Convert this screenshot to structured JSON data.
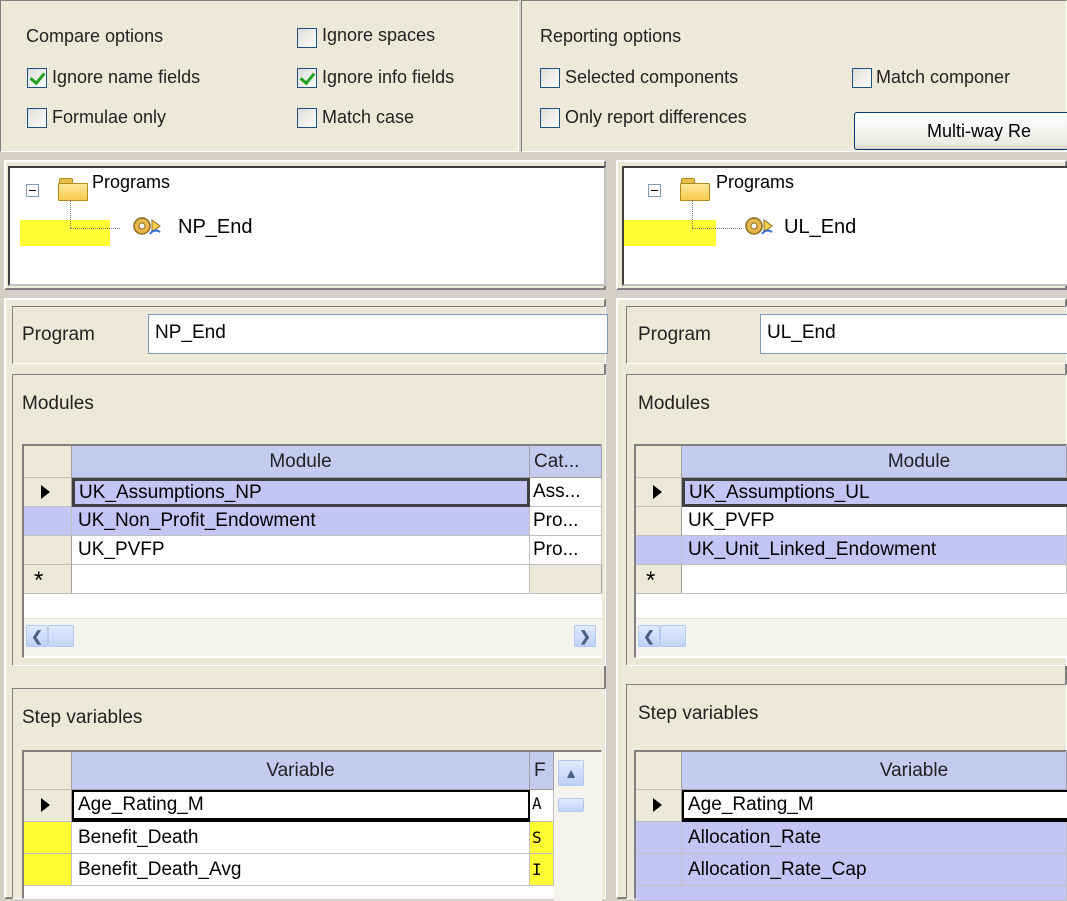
{
  "compare_options": {
    "title": "Compare options",
    "ignore_name_fields": {
      "label": "Ignore name fields",
      "checked": true
    },
    "formulae_only": {
      "label": "Formulae only",
      "checked": false
    },
    "ignore_spaces": {
      "label": "Ignore spaces",
      "checked": false
    },
    "ignore_info_fields": {
      "label": "Ignore info fields",
      "checked": true
    },
    "match_case": {
      "label": "Match case",
      "checked": false
    }
  },
  "reporting_options": {
    "title": "Reporting options",
    "selected_components": {
      "label": "Selected components",
      "checked": false
    },
    "only_report_differences": {
      "label": "Only report differences",
      "checked": false
    },
    "match_components": {
      "label": "Match componer",
      "checked": false
    },
    "multiway_button": "Multi-way Re"
  },
  "left": {
    "tree": {
      "root": "Programs",
      "child": "NP_End"
    },
    "program_label": "Program",
    "program_value": "NP_End",
    "modules": {
      "title": "Modules",
      "columns": [
        "Module",
        "Cat..."
      ],
      "rows": [
        {
          "module": "UK_Assumptions_NP",
          "cat": "Ass...",
          "current": true
        },
        {
          "module": "UK_Non_Profit_Endowment",
          "cat": "Pro...",
          "current": false
        },
        {
          "module": "UK_PVFP",
          "cat": "Pro...",
          "current": false
        }
      ],
      "new_row_marker": "*"
    },
    "step_variables": {
      "title": "Step variables",
      "columns": [
        "Variable",
        "F"
      ],
      "rows": [
        {
          "variable": "Age_Rating_M",
          "flag": "A",
          "current": true
        },
        {
          "variable": "Benefit_Death",
          "flag": "S",
          "current": false
        },
        {
          "variable": "Benefit_Death_Avg",
          "flag": "I",
          "current": false
        }
      ]
    }
  },
  "right": {
    "tree": {
      "root": "Programs",
      "child": "UL_End"
    },
    "program_label": "Program",
    "program_value": "UL_End",
    "modules": {
      "title": "Modules",
      "columns": [
        "Module"
      ],
      "rows": [
        {
          "module": "UK_Assumptions_UL",
          "current": true
        },
        {
          "module": "UK_PVFP",
          "current": false
        },
        {
          "module": "UK_Unit_Linked_Endowment",
          "current": false
        }
      ],
      "new_row_marker": "*"
    },
    "step_variables": {
      "title": "Step variables",
      "columns": [
        "Variable"
      ],
      "rows": [
        {
          "variable": "Age_Rating_M",
          "current": true
        },
        {
          "variable": "Allocation_Rate",
          "current": false
        },
        {
          "variable": "Allocation_Rate_Cap",
          "current": false
        }
      ]
    }
  },
  "colors": {
    "header": "#c3cbef",
    "purple_row": "#c3c6f5",
    "yellow_highlight": "#ffff33",
    "check": "#21a121"
  },
  "icons": [
    "checkbox-checked-icon",
    "checkbox-unchecked-icon",
    "tree-collapse-icon",
    "folder-open-icon",
    "program-gear-icon",
    "row-pointer-icon",
    "scroll-left-icon",
    "scroll-right-icon",
    "scroll-up-icon"
  ]
}
